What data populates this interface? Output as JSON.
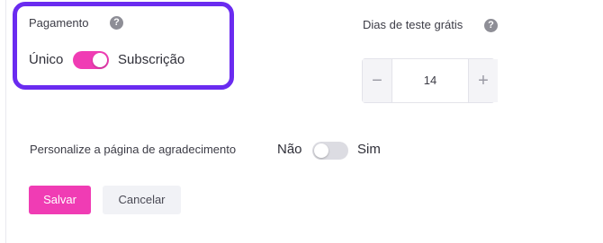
{
  "payment": {
    "label": "Pagamento",
    "help_icon": "question-circle-icon",
    "option_left": "Único",
    "option_right": "Subscrição",
    "toggle_on": true,
    "highlight_color": "#6a2bf0",
    "toggle_color": "#f03cb4"
  },
  "trial": {
    "label": "Dias de teste grátis",
    "help_icon": "question-circle-icon",
    "minus": "−",
    "value": "14",
    "plus": "+"
  },
  "thanks_page": {
    "label": "Personalize a página de agradecimento",
    "option_no": "Não",
    "option_yes": "Sim",
    "toggle_on": false
  },
  "actions": {
    "save_label": "Salvar",
    "cancel_label": "Cancelar",
    "save_color": "#f03cb4"
  },
  "icons": {
    "help_glyph": "?"
  }
}
